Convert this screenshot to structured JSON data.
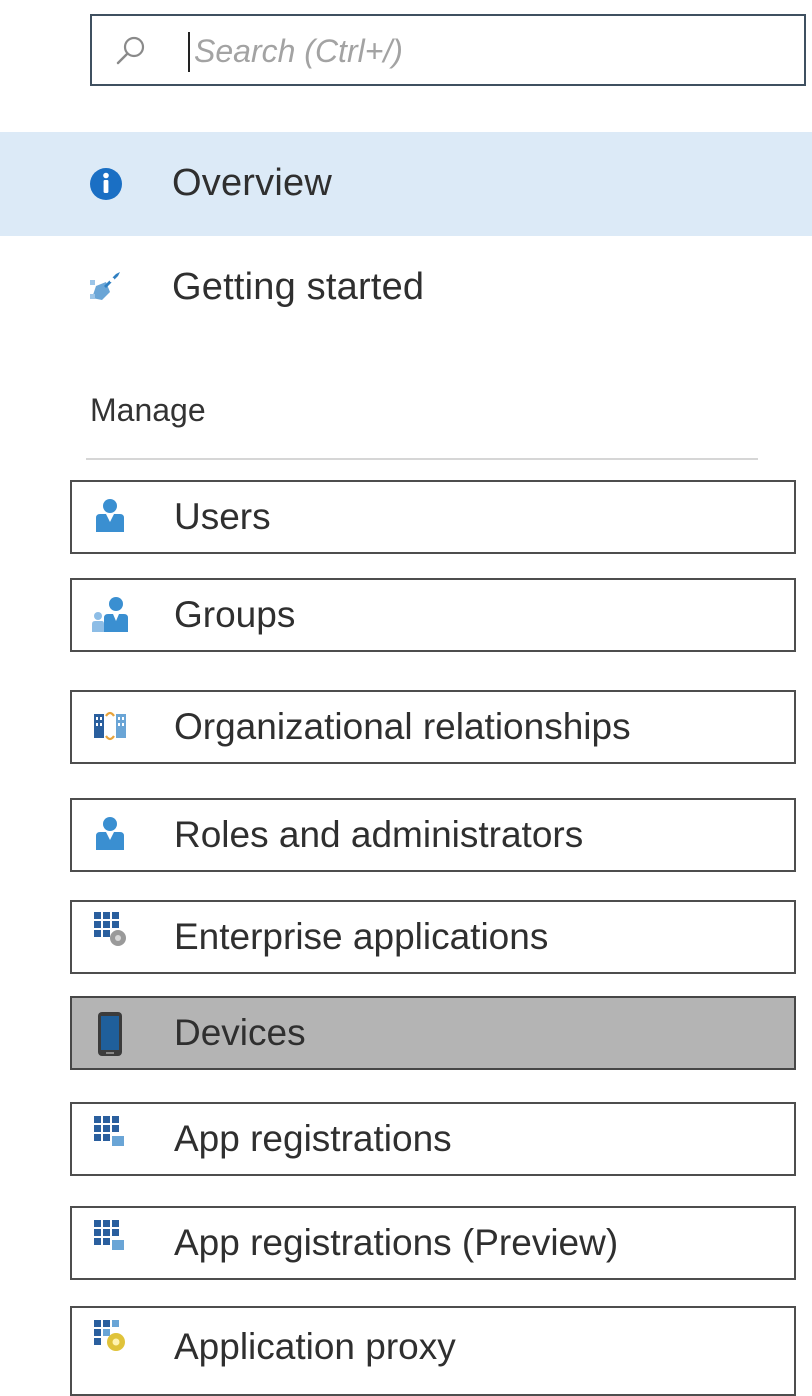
{
  "search": {
    "placeholder": "Search (Ctrl+/)"
  },
  "nav": {
    "overview": {
      "label": "Overview",
      "icon": "info-icon"
    },
    "getting_started": {
      "label": "Getting started",
      "icon": "rocket-icon"
    }
  },
  "manage": {
    "header": "Manage",
    "items": [
      {
        "label": "Users",
        "icon": "user-icon"
      },
      {
        "label": "Groups",
        "icon": "group-icon"
      },
      {
        "label": "Organizational relationships",
        "icon": "org-relationships-icon"
      },
      {
        "label": "Roles and administrators",
        "icon": "roles-icon"
      },
      {
        "label": "Enterprise applications",
        "icon": "enterprise-apps-icon"
      },
      {
        "label": "Devices",
        "icon": "device-icon"
      },
      {
        "label": "App registrations",
        "icon": "app-registrations-icon"
      },
      {
        "label": "App registrations (Preview)",
        "icon": "app-registrations-preview-icon"
      },
      {
        "label": "Application proxy",
        "icon": "app-proxy-icon"
      }
    ]
  },
  "colors": {
    "selected_background": "#dceaf7",
    "active_item_background": "#b4b4b4",
    "accent_blue": "#1a6fc4",
    "icon_blue": "#2f7fc1"
  }
}
